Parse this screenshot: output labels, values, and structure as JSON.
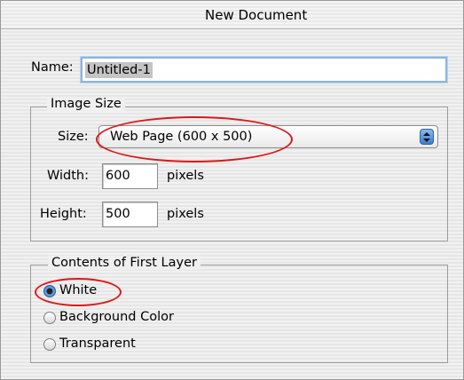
{
  "window": {
    "title": "New Document"
  },
  "name": {
    "label": "Name:",
    "value": "Untitled-1"
  },
  "image_size": {
    "legend": "Image Size",
    "size_label": "Size:",
    "size_value": "Web Page (600 x 500)",
    "width_label": "Width:",
    "width_value": "600",
    "width_unit": "pixels",
    "height_label": "Height:",
    "height_value": "500",
    "height_unit": "pixels"
  },
  "contents": {
    "legend": "Contents of First Layer",
    "options": [
      {
        "label": "White",
        "selected": true
      },
      {
        "label": "Background Color",
        "selected": false
      },
      {
        "label": "Transparent",
        "selected": false
      }
    ]
  },
  "colors": {
    "annotation": "#dd1818",
    "focus": "#8eb4dc",
    "stepper": "#3e7ed0"
  }
}
